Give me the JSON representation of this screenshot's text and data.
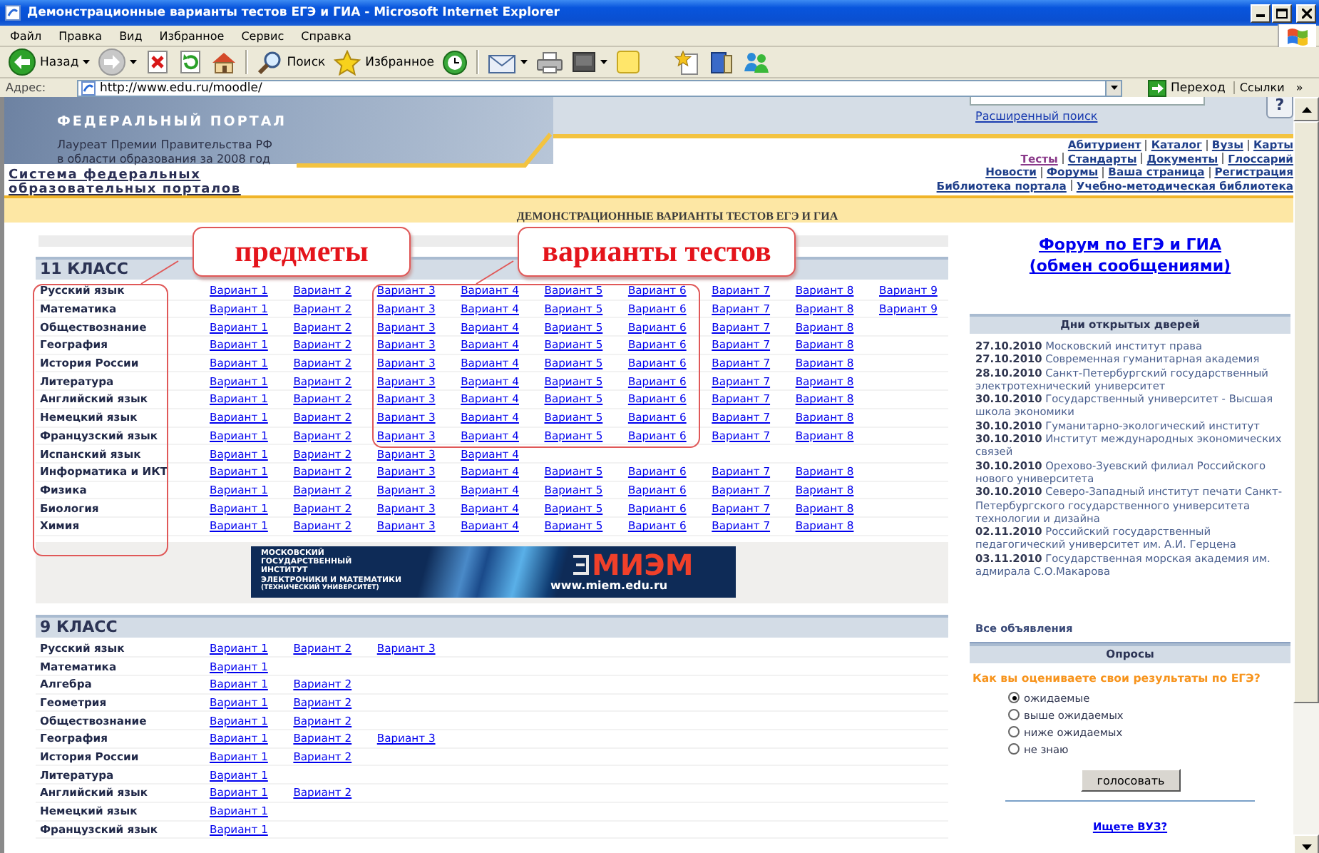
{
  "window": {
    "title": "Демонстрационные варианты тестов ЕГЭ и ГИА - Microsoft Internet Explorer"
  },
  "menu": [
    "Файл",
    "Правка",
    "Вид",
    "Избранное",
    "Сервис",
    "Справка"
  ],
  "toolbar": [
    {
      "kind": "back",
      "label": "Назад",
      "dropdown": true
    },
    {
      "kind": "forward",
      "dropdown": true
    },
    {
      "kind": "stop"
    },
    {
      "kind": "refresh"
    },
    {
      "kind": "home"
    },
    {
      "kind": "separator"
    },
    {
      "kind": "search",
      "label": "Поиск"
    },
    {
      "kind": "favorites",
      "label": "Избранное"
    },
    {
      "kind": "history"
    },
    {
      "kind": "separator"
    },
    {
      "kind": "mail",
      "dropdown": true
    },
    {
      "kind": "print"
    },
    {
      "kind": "edit",
      "dropdown": true
    },
    {
      "kind": "note"
    },
    {
      "kind": "gap"
    },
    {
      "kind": "favorite-add"
    },
    {
      "kind": "research"
    },
    {
      "kind": "messenger"
    }
  ],
  "address": {
    "label": "Адрес:",
    "value": "http://www.edu.ru/moodle/",
    "go": "Переход",
    "links": "Ссылки",
    "more": "»"
  },
  "site_header": {
    "portal": "ФЕДЕРАЛЬНЫЙ ПОРТАЛ",
    "award": [
      "Лауреат Премии Правительства РФ",
      "в области образования за 2008 год"
    ],
    "advanced_search": "Расширенный поиск",
    "help": "?",
    "portals_link": "Система федеральных образовательных порталов",
    "nav": [
      [
        {
          "label": "Абитуриент",
          "visited": false
        },
        {
          "label": "Каталог",
          "visited": false
        },
        {
          "label": "Вузы",
          "visited": false
        },
        {
          "label": "Карты",
          "visited": false
        }
      ],
      [
        {
          "label": "Тесты",
          "visited": true
        },
        {
          "label": "Стандарты",
          "visited": false
        },
        {
          "label": "Документы",
          "visited": false
        },
        {
          "label": "Глоссарий",
          "visited": false
        }
      ],
      [
        {
          "label": "Новости",
          "visited": false
        },
        {
          "label": "Форумы",
          "visited": false
        },
        {
          "label": "Ваша страница",
          "visited": false
        },
        {
          "label": "Регистрация",
          "visited": false
        }
      ],
      [
        {
          "label": "Библиотека портала",
          "visited": false
        },
        {
          "label": "Учебно-методическая библиотека",
          "visited": false
        }
      ]
    ]
  },
  "page_title": "ДЕМОНСТРАЦИОННЫЕ ВАРИАНТЫ ТЕСТОВ ЕГЭ И ГИА",
  "annotations": [
    {
      "label": "предметы"
    },
    {
      "label": "варианты тестов"
    }
  ],
  "grades": [
    {
      "title": "11 КЛАСС",
      "subjects": [
        {
          "name": "Русский язык",
          "variants": [
            "Вариант 1",
            "Вариант 2",
            "Вариант 3",
            "Вариант 4",
            "Вариант 5",
            "Вариант 6",
            "Вариант 7",
            "Вариант 8",
            "Вариант 9"
          ]
        },
        {
          "name": "Математика",
          "variants": [
            "Вариант 1",
            "Вариант 2",
            "Вариант 3",
            "Вариант 4",
            "Вариант 5",
            "Вариант 6",
            "Вариант 7",
            "Вариант 8",
            "Вариант 9"
          ]
        },
        {
          "name": "Обществознание",
          "variants": [
            "Вариант 1",
            "Вариант 2",
            "Вариант 3",
            "Вариант 4",
            "Вариант 5",
            "Вариант 6",
            "Вариант 7",
            "Вариант 8"
          ]
        },
        {
          "name": "География",
          "variants": [
            "Вариант 1",
            "Вариант 2",
            "Вариант 3",
            "Вариант 4",
            "Вариант 5",
            "Вариант 6",
            "Вариант 7",
            "Вариант 8"
          ]
        },
        {
          "name": "История России",
          "variants": [
            "Вариант 1",
            "Вариант 2",
            "Вариант 3",
            "Вариант 4",
            "Вариант 5",
            "Вариант 6",
            "Вариант 7",
            "Вариант 8"
          ]
        },
        {
          "name": "Литература",
          "variants": [
            "Вариант 1",
            "Вариант 2",
            "Вариант 3",
            "Вариант 4",
            "Вариант 5",
            "Вариант 6",
            "Вариант 7",
            "Вариант 8"
          ]
        },
        {
          "name": "Английский язык",
          "variants": [
            "Вариант 1",
            "Вариант 2",
            "Вариант 3",
            "Вариант 4",
            "Вариант 5",
            "Вариант 6",
            "Вариант 7",
            "Вариант 8"
          ]
        },
        {
          "name": "Немецкий язык",
          "variants": [
            "Вариант 1",
            "Вариант 2",
            "Вариант 3",
            "Вариант 4",
            "Вариант 5",
            "Вариант 6",
            "Вариант 7",
            "Вариант 8"
          ]
        },
        {
          "name": "Французский язык",
          "variants": [
            "Вариант 1",
            "Вариант 2",
            "Вариант 3",
            "Вариант 4",
            "Вариант 5",
            "Вариант 6",
            "Вариант 7",
            "Вариант 8"
          ]
        },
        {
          "name": "Испанский язык",
          "variants": [
            "Вариант 1",
            "Вариант 2",
            "Вариант 3",
            "Вариант 4"
          ]
        },
        {
          "name": "Информатика и ИКТ",
          "variants": [
            "Вариант 1",
            "Вариант 2",
            "Вариант 3",
            "Вариант 4",
            "Вариант 5",
            "Вариант 6",
            "Вариант 7",
            "Вариант 8"
          ]
        },
        {
          "name": "Физика",
          "variants": [
            "Вариант 1",
            "Вариант 2",
            "Вариант 3",
            "Вариант 4",
            "Вариант 5",
            "Вариант 6",
            "Вариант 7",
            "Вариант 8"
          ]
        },
        {
          "name": "Биология",
          "variants": [
            "Вариант 1",
            "Вариант 2",
            "Вариант 3",
            "Вариант 4",
            "Вариант 5",
            "Вариант 6",
            "Вариант 7",
            "Вариант 8"
          ]
        },
        {
          "name": "Химия",
          "variants": [
            "Вариант 1",
            "Вариант 2",
            "Вариант 3",
            "Вариант 4",
            "Вариант 5",
            "Вариант 6",
            "Вариант 7",
            "Вариант 8"
          ]
        }
      ]
    },
    {
      "title": "9 КЛАСС",
      "subjects": [
        {
          "name": "Русский язык",
          "variants": [
            "Вариант 1",
            "Вариант 2",
            "Вариант 3"
          ]
        },
        {
          "name": "Математика",
          "variants": [
            "Вариант 1"
          ]
        },
        {
          "name": "Алгебра",
          "variants": [
            "Вариант 1",
            "Вариант 2"
          ]
        },
        {
          "name": "Геометрия",
          "variants": [
            "Вариант 1",
            "Вариант 2"
          ]
        },
        {
          "name": "Обществознание",
          "variants": [
            "Вариант 1",
            "Вариант 2"
          ]
        },
        {
          "name": "География",
          "variants": [
            "Вариант 1",
            "Вариант 2",
            "Вариант 3"
          ]
        },
        {
          "name": "История России",
          "variants": [
            "Вариант 1",
            "Вариант 2"
          ]
        },
        {
          "name": "Литература",
          "variants": [
            "Вариант 1"
          ]
        },
        {
          "name": "Английский язык",
          "variants": [
            "Вариант 1",
            "Вариант 2"
          ]
        },
        {
          "name": "Немецкий язык",
          "variants": [
            "Вариант 1"
          ]
        },
        {
          "name": "Французский язык",
          "variants": [
            "Вариант 1"
          ]
        }
      ]
    }
  ],
  "banner": {
    "lines": [
      "МОСКОВСКИЙ",
      "ГОСУДАРСТВЕННЫЙ",
      "ИНСТИТУТ",
      "ЭЛЕКТРОНИКИ И МАТЕМАТИКИ"
    ],
    "subtitle": "(ТЕХНИЧЕСКИЙ УНИВЕРСИТЕТ)",
    "logo": "МИЭМ",
    "url": "www.miem.edu.ru"
  },
  "sidebar": {
    "forum_link": [
      "Форум по ЕГЭ и ГИА",
      "(обмен сообщениями)"
    ],
    "open_days": {
      "title": "Дни открытых дверей",
      "events": [
        {
          "date": "27.10.2010",
          "text": "Московский институт права"
        },
        {
          "date": "27.10.2010",
          "text": "Современная гуманитарная академия"
        },
        {
          "date": "28.10.2010",
          "text": "Санкт-Петербургский государственный электротехнический университет"
        },
        {
          "date": "30.10.2010",
          "text": "Государственный университет - Высшая школа экономики"
        },
        {
          "date": "30.10.2010",
          "text": "Гуманитарно-экологический институт"
        },
        {
          "date": "30.10.2010",
          "text": "Институт международных экономических связей"
        },
        {
          "date": "30.10.2010",
          "text": "Орехово-Зуевский филиал Российского нового университета"
        },
        {
          "date": "30.10.2010",
          "text": "Северо-Западный институт печати Санкт-Петербургского государственного университета технологии и дизайна"
        },
        {
          "date": "02.11.2010",
          "text": "Российский государственный педагогический университет им. А.И. Герцена"
        },
        {
          "date": "03.11.2010",
          "text": "Государственная морская академия им. адмирала С.О.Макарова"
        }
      ],
      "all_link": "Все объявления"
    },
    "poll": {
      "title": "Опросы",
      "question": "Как вы оцениваете свои результаты по ЕГЭ?",
      "options": [
        {
          "label": "ожидаемые",
          "selected": true
        },
        {
          "label": "выше ожидаемых",
          "selected": false
        },
        {
          "label": "ниже ожидаемых",
          "selected": false
        },
        {
          "label": "не знаю",
          "selected": false
        }
      ],
      "button": "голосовать"
    },
    "search_link": "Ищете ВУЗ?"
  }
}
